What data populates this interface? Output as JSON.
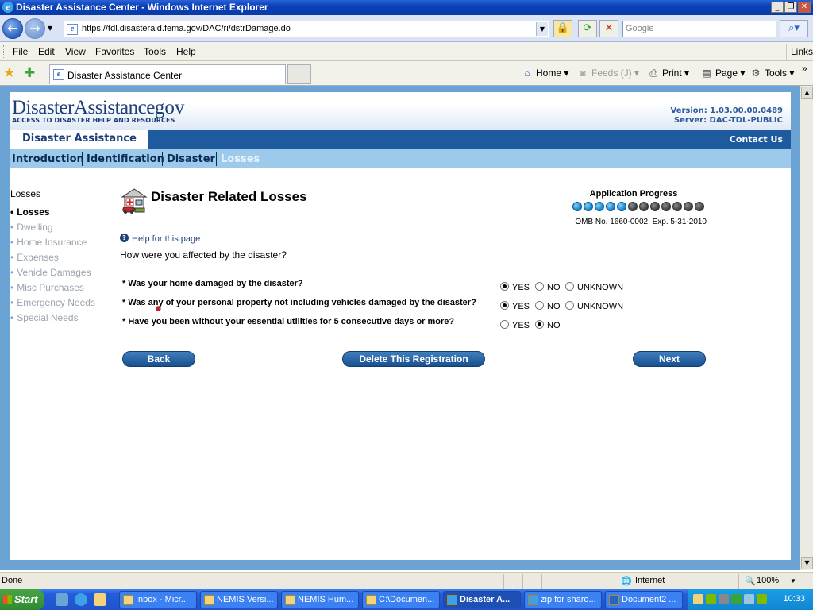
{
  "window": {
    "title": "Disaster Assistance Center - Windows Internet Explorer",
    "url": "https://tdl.disasteraid.fema.gov/DAC/ri/dstrDamage.do",
    "search_placeholder": "Google",
    "menu": [
      "File",
      "Edit",
      "View",
      "Favorites",
      "Tools",
      "Help"
    ],
    "links_label": "Links",
    "tab_title": "Disaster Assistance Center",
    "commands": {
      "home": "Home",
      "feeds": "Feeds (J)",
      "print": "Print",
      "page": "Page",
      "tools": "Tools"
    }
  },
  "site": {
    "logo_text": "DisasterAssistance",
    "logo_dot": "•",
    "logo_gov": "gov",
    "logo_tagline": "ACCESS TO DISASTER HELP AND RESOURCES",
    "version": "Version: 1.03.00.00.0489",
    "server": "Server: DAC-TDL-PUBLIC",
    "nav_title": "Disaster Assistance",
    "contact": "Contact Us",
    "tabs": [
      "Introduction",
      "Identification",
      "Disaster",
      "Losses"
    ]
  },
  "left_nav": {
    "title": "Losses",
    "items": [
      "Losses",
      "Dwelling",
      "Home Insurance",
      "Expenses",
      "Vehicle Damages",
      "Misc Purchases",
      "Emergency Needs",
      "Special Needs"
    ]
  },
  "main": {
    "title": "Disaster Related Losses",
    "progress_label": "Application Progress",
    "progress_done": 5,
    "progress_total": 12,
    "omb": "OMB No. 1660-0002, Exp. 5-31-2010",
    "help": "Help for this page",
    "intro": "How were you affected by the disaster?",
    "questions": [
      {
        "text": "* Was your home damaged by the disaster?",
        "options": [
          "YES",
          "NO",
          "UNKNOWN"
        ],
        "selected": "YES"
      },
      {
        "text": "* Was any of your personal property not including vehicles damaged by the disaster?",
        "options": [
          "YES",
          "NO",
          "UNKNOWN"
        ],
        "selected": "YES"
      },
      {
        "text": "* Have you been without your essential utilities for 5 consecutive days or more?",
        "options": [
          "YES",
          "NO"
        ],
        "selected": "NO"
      }
    ],
    "buttons": {
      "back": "Back",
      "delete": "Delete This Registration",
      "next": "Next"
    }
  },
  "status": {
    "left": "Done",
    "zone": "Internet",
    "zoom": "100%"
  },
  "taskbar": {
    "start": "Start",
    "tasks": [
      "Inbox - Micr...",
      "NEMIS Versi...",
      "NEMIS Hum...",
      "C:\\Documen...",
      "Disaster A...",
      "zip for sharo...",
      "Document2 ..."
    ],
    "clock": "10:33"
  }
}
